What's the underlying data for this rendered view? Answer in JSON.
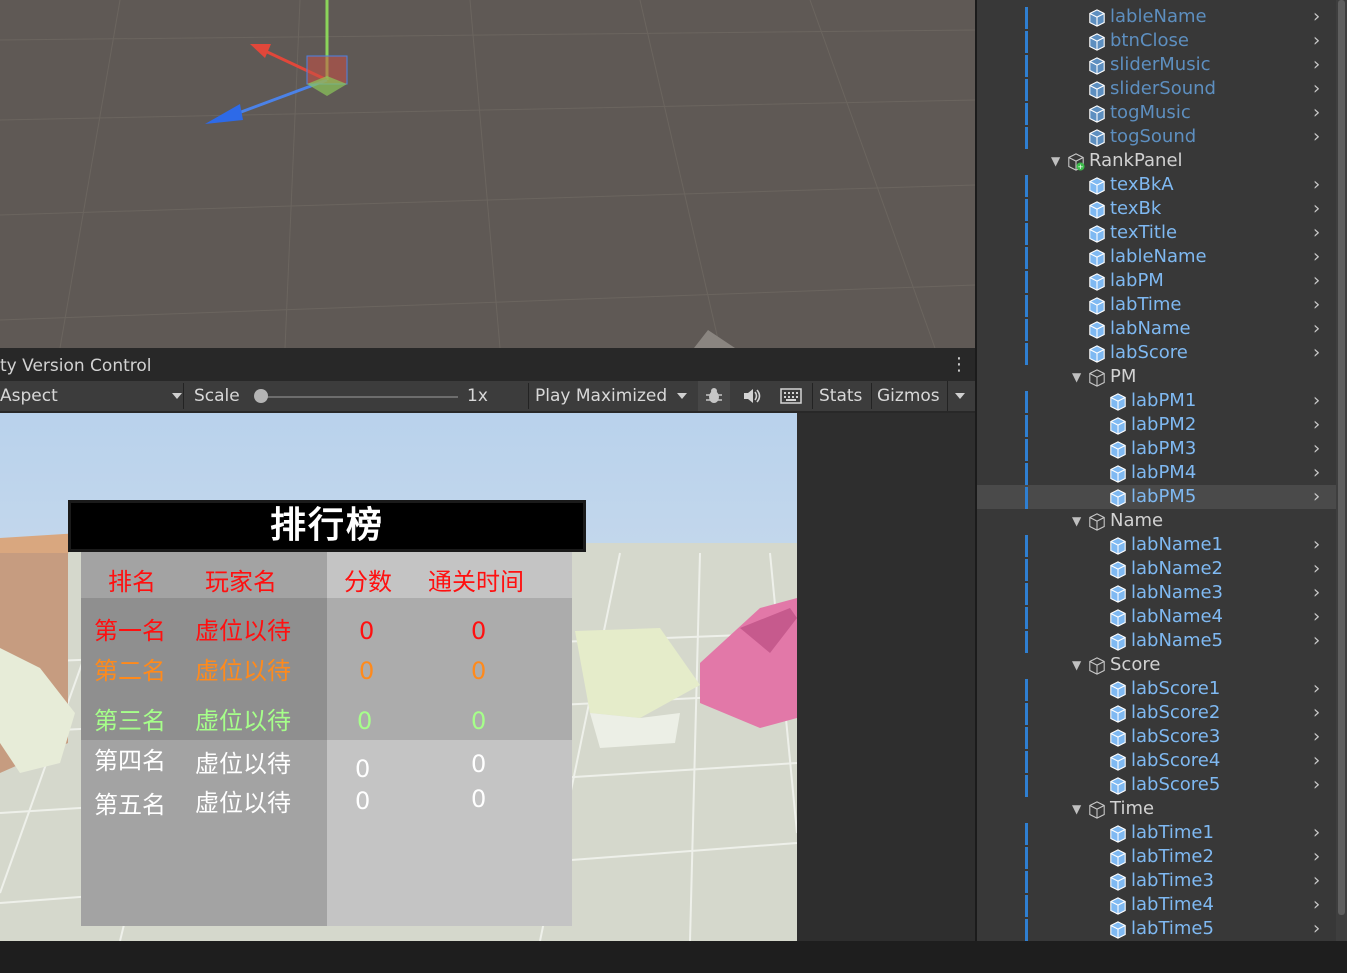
{
  "scene_view": {},
  "uvc_bar": {
    "title": "ty Version Control",
    "more_icon": "kebab-menu-icon"
  },
  "game_toolbar": {
    "aspect": "Aspect",
    "scale_label": "Scale",
    "scale_value": "1x",
    "scale_fraction": 0.0,
    "play_mode": "Play Maximized",
    "stats": "Stats",
    "gizmos": "Gizmos",
    "icons": [
      "bug-icon",
      "speaker-icon",
      "keyboard-icon"
    ]
  },
  "rank_panel": {
    "title": "排行榜",
    "headers": [
      "排名",
      "玩家名",
      "分数",
      "通关时间"
    ],
    "rows": [
      {
        "rank": "第一名",
        "name": "虚位以待",
        "score": "0",
        "time": "0",
        "color": "#ff1010"
      },
      {
        "rank": "第二名",
        "name": "虚位以待",
        "score": "0",
        "time": "0",
        "color": "#ff8a1c"
      },
      {
        "rank": "第三名",
        "name": "虚位以待",
        "score": "0",
        "time": "0",
        "color": "#a6ff8a"
      },
      {
        "rank": "第四名",
        "name": "虚位以待",
        "score": "0",
        "time": "0",
        "color": "#ffffff"
      },
      {
        "rank": "第五名",
        "name": "虚位以待",
        "score": "0",
        "time": "0",
        "color": "#ffffff"
      }
    ],
    "header_color": "#ff1010"
  },
  "hierarchy": {
    "items": [
      {
        "label": "lableName",
        "icon": "prefab-cube-icon",
        "dim": true,
        "chevron": true
      },
      {
        "label": "btnClose",
        "icon": "prefab-cube-icon",
        "dim": true,
        "chevron": true
      },
      {
        "label": "sliderMusic",
        "icon": "prefab-cube-icon",
        "dim": true,
        "chevron": true
      },
      {
        "label": "sliderSound",
        "icon": "prefab-cube-icon",
        "dim": true,
        "chevron": true
      },
      {
        "label": "togMusic",
        "icon": "prefab-cube-icon",
        "dim": true,
        "chevron": true
      },
      {
        "label": "togSound",
        "icon": "prefab-cube-icon",
        "dim": true,
        "chevron": true
      },
      {
        "label": "RankPanel",
        "icon": "gameobject-added-icon",
        "folder": true
      },
      {
        "label": "texBkA",
        "icon": "prefab-cube-icon",
        "chevron": true
      },
      {
        "label": "texBk",
        "icon": "prefab-cube-icon",
        "chevron": true
      },
      {
        "label": "texTitle",
        "icon": "prefab-cube-icon",
        "chevron": true
      },
      {
        "label": "lableName",
        "icon": "prefab-cube-icon",
        "chevron": true
      },
      {
        "label": "labPM",
        "icon": "prefab-cube-icon",
        "chevron": true
      },
      {
        "label": "labTime",
        "icon": "prefab-cube-icon",
        "chevron": true
      },
      {
        "label": "labName",
        "icon": "prefab-cube-icon",
        "chevron": true
      },
      {
        "label": "labScore",
        "icon": "prefab-cube-icon",
        "chevron": true
      },
      {
        "label": "PM",
        "icon": "gameobject-icon",
        "folder": true
      },
      {
        "label": "labPM1",
        "icon": "prefab-cube-icon",
        "chevron": true
      },
      {
        "label": "labPM2",
        "icon": "prefab-cube-icon",
        "chevron": true
      },
      {
        "label": "labPM3",
        "icon": "prefab-cube-icon",
        "chevron": true
      },
      {
        "label": "labPM4",
        "icon": "prefab-cube-icon",
        "chevron": true
      },
      {
        "label": "labPM5",
        "icon": "prefab-cube-icon",
        "chevron": true,
        "selected": true
      },
      {
        "label": "Name",
        "icon": "gameobject-icon",
        "folder": true
      },
      {
        "label": "labName1",
        "icon": "prefab-cube-icon",
        "chevron": true
      },
      {
        "label": "labName2",
        "icon": "prefab-cube-icon",
        "chevron": true
      },
      {
        "label": "labName3",
        "icon": "prefab-cube-icon",
        "chevron": true
      },
      {
        "label": "labName4",
        "icon": "prefab-cube-icon",
        "chevron": true
      },
      {
        "label": "labName5",
        "icon": "prefab-cube-icon",
        "chevron": true
      },
      {
        "label": "Score",
        "icon": "gameobject-icon",
        "folder": true
      },
      {
        "label": "labScore1",
        "icon": "prefab-cube-icon",
        "chevron": true
      },
      {
        "label": "labScore2",
        "icon": "prefab-cube-icon",
        "chevron": true
      },
      {
        "label": "labScore3",
        "icon": "prefab-cube-icon",
        "chevron": true
      },
      {
        "label": "labScore4",
        "icon": "prefab-cube-icon",
        "chevron": true
      },
      {
        "label": "labScore5",
        "icon": "prefab-cube-icon",
        "chevron": true
      },
      {
        "label": "Time",
        "icon": "gameobject-icon",
        "folder": true
      },
      {
        "label": "labTime1",
        "icon": "prefab-cube-icon",
        "chevron": true
      },
      {
        "label": "labTime2",
        "icon": "prefab-cube-icon",
        "chevron": true
      },
      {
        "label": "labTime3",
        "icon": "prefab-cube-icon",
        "chevron": true
      },
      {
        "label": "labTime4",
        "icon": "prefab-cube-icon",
        "chevron": true
      },
      {
        "label": "labTime5",
        "icon": "prefab-cube-icon",
        "chevron": true
      }
    ],
    "colors": {
      "prefab": "#7fb9f2",
      "prefab_dim": "#5d8fc0",
      "normal": "#d2d2d2"
    }
  }
}
